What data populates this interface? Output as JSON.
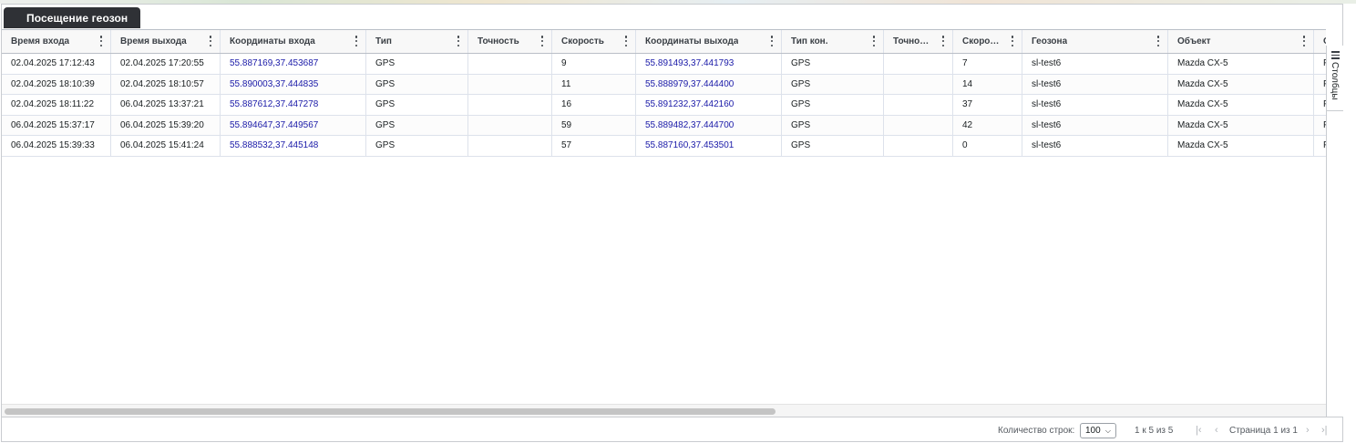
{
  "tab": {
    "label": "Посещение геозон"
  },
  "columns": [
    {
      "label": "Время входа"
    },
    {
      "label": "Время выхода"
    },
    {
      "label": "Координаты входа"
    },
    {
      "label": "Тип"
    },
    {
      "label": "Точность"
    },
    {
      "label": "Скорость"
    },
    {
      "label": "Координаты выхода"
    },
    {
      "label": "Тип кон."
    },
    {
      "label": "Точно…"
    },
    {
      "label": "Скоро…"
    },
    {
      "label": "Геозона"
    },
    {
      "label": "Объект"
    },
    {
      "label": "О"
    }
  ],
  "rows": [
    [
      "02.04.2025 17:12:43",
      "02.04.2025 17:20:55",
      "55.887169,37.453687",
      "GPS",
      "",
      "9",
      "55.891493,37.441793",
      "GPS",
      "",
      "7",
      "sl-test6",
      "Mazda CX-5",
      "P"
    ],
    [
      "02.04.2025 18:10:39",
      "02.04.2025 18:10:57",
      "55.890003,37.444835",
      "GPS",
      "",
      "11",
      "55.888979,37.444400",
      "GPS",
      "",
      "14",
      "sl-test6",
      "Mazda CX-5",
      "P"
    ],
    [
      "02.04.2025 18:11:22",
      "06.04.2025 13:37:21",
      "55.887612,37.447278",
      "GPS",
      "",
      "16",
      "55.891232,37.442160",
      "GPS",
      "",
      "37",
      "sl-test6",
      "Mazda CX-5",
      "P"
    ],
    [
      "06.04.2025 15:37:17",
      "06.04.2025 15:39:20",
      "55.894647,37.449567",
      "GPS",
      "",
      "59",
      "55.889482,37.444700",
      "GPS",
      "",
      "42",
      "sl-test6",
      "Mazda CX-5",
      "P"
    ],
    [
      "06.04.2025 15:39:33",
      "06.04.2025 15:41:24",
      "55.888532,37.445148",
      "GPS",
      "",
      "57",
      "55.887160,37.453501",
      "GPS",
      "",
      "0",
      "sl-test6",
      "Mazda CX-5",
      "P"
    ]
  ],
  "side_panel": {
    "columns_label": "Столбцы",
    "icon": "columns-menu-icon"
  },
  "footer": {
    "rows_count_label": "Количество строк:",
    "rows_per_page": "100",
    "range_text": "1 к 5 из 5",
    "page_text": "Страница 1 из 1",
    "first_glyph": "|‹",
    "prev_glyph": "‹",
    "next_glyph": "›",
    "last_glyph": "›|"
  },
  "colors": {
    "tab_bg": "#2f3136",
    "link": "#1a1aa8",
    "header_bg": "#f8f8f8"
  }
}
